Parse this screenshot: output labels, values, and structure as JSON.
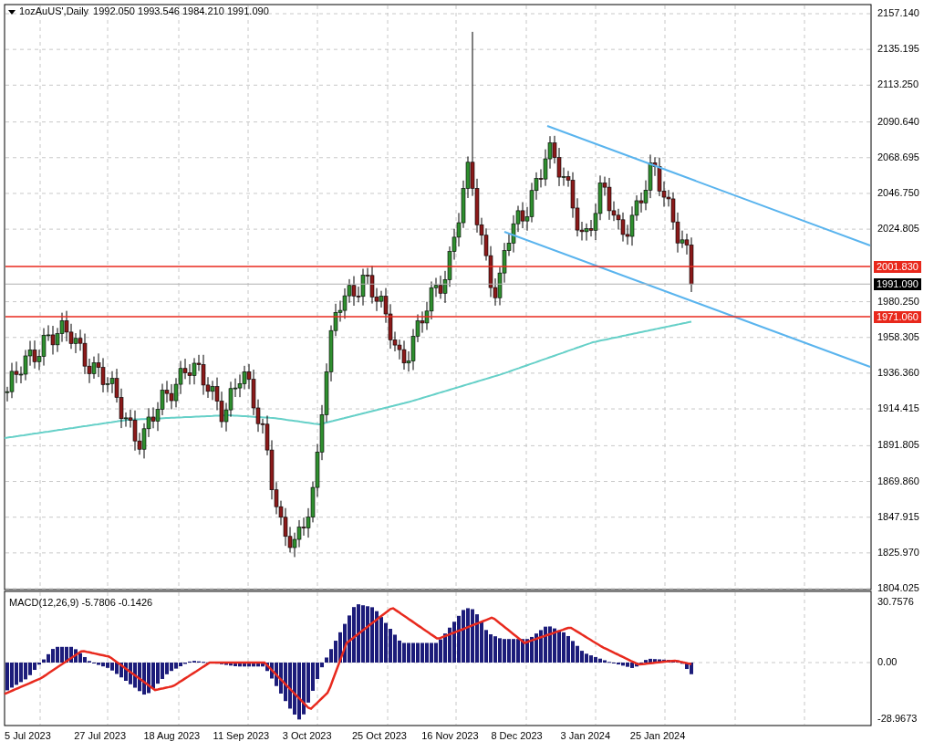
{
  "header": {
    "symbol": "1ozAuUS',Daily",
    "quote": "1992.050 1993.546 1984.210 1991.090"
  },
  "price_axis": [
    "2157.140",
    "2135.195",
    "2113.250",
    "2090.640",
    "2068.695",
    "2046.750",
    "2024.805",
    "1980.250",
    "1958.305",
    "1936.360",
    "1914.415",
    "1891.805",
    "1869.860",
    "1847.915",
    "1825.970",
    "1804.025"
  ],
  "price_tags": [
    {
      "text": "2001.830",
      "kind": "level"
    },
    {
      "text": "1991.090",
      "kind": "current"
    },
    {
      "text": "1971.060",
      "kind": "level"
    }
  ],
  "macd": {
    "label": "MACD(12,26,9) -5.7806 -0.1426",
    "ticks": [
      "30.7576",
      "0.00",
      "-28.9673"
    ]
  },
  "time_axis": [
    "5 Jul 2023",
    "27 Jul 2023",
    "18 Aug 2023",
    "11 Sep 2023",
    "3 Oct 2023",
    "25 Oct 2023",
    "16 Nov 2023",
    "8 Dec 2023",
    "3 Jan 2024",
    "25 Jan 2024"
  ]
}
